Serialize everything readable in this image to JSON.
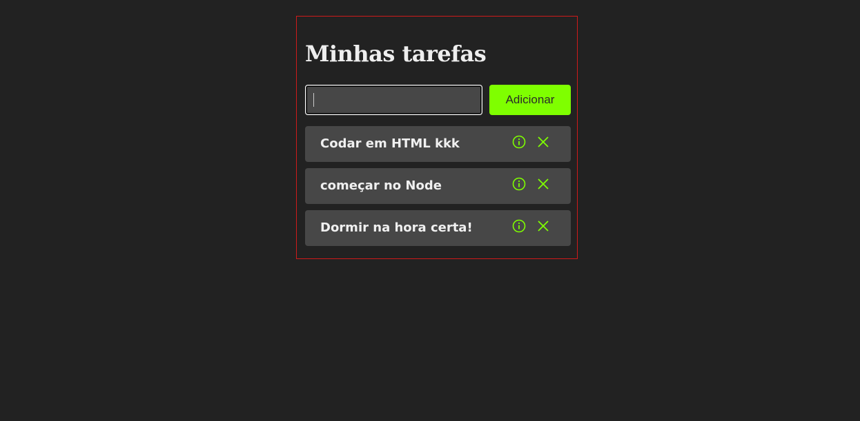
{
  "header": {
    "title": "Minhas tarefas"
  },
  "form": {
    "input_value": "",
    "add_label": "Adicionar"
  },
  "tasks": [
    {
      "label": "Codar em HTML kkk"
    },
    {
      "label": "começar no Node"
    },
    {
      "label": "Dormir na hora certa!"
    }
  ],
  "colors": {
    "accent": "#7fff00",
    "background": "#222222",
    "item_background": "#474747",
    "border": "#d11a1a"
  },
  "icons": {
    "info": "info-circle-icon",
    "delete": "close-icon"
  }
}
